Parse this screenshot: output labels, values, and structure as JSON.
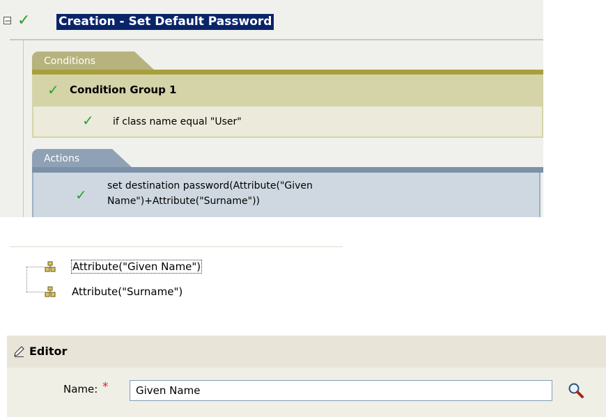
{
  "rule": {
    "title": "Creation - Set Default Password",
    "collapse_glyph": "−"
  },
  "conditions": {
    "tab_label": "Conditions",
    "group_label": "Condition Group 1",
    "condition_label": "if class name equal \"User\""
  },
  "actions": {
    "tab_label": "Actions",
    "action_label": "set destination password(Attribute(\"Given Name\")+Attribute(\"Surname\"))"
  },
  "tree": {
    "items": [
      {
        "label": "Attribute(\"Given Name\")",
        "icon": "attribute-icon"
      },
      {
        "label": "Attribute(\"Surname\")",
        "icon": "attribute-icon"
      }
    ]
  },
  "editor": {
    "title": "Editor",
    "name_label": "Name:",
    "required_marker": "*",
    "name_value": "Given Name"
  },
  "icons": {
    "check": "✓",
    "check_color": "#2ca02c",
    "title_highlight": "#0a246a"
  }
}
